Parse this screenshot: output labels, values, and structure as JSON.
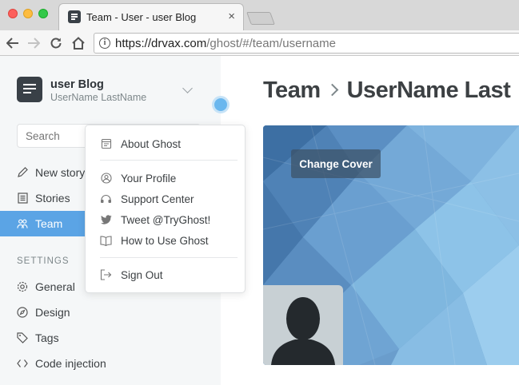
{
  "browser": {
    "tab_title": "Team - User - user Blog",
    "tab_close": "×",
    "url_host": "https://drvax.com",
    "url_rest": "/ghost/#/team/username"
  },
  "sidebar": {
    "blog_title": "user Blog",
    "user_name": "UserName LastName",
    "search_placeholder": "Search",
    "nav_items": [
      {
        "label": "New story",
        "icon": "pencil-icon"
      },
      {
        "label": "Stories",
        "icon": "stories-icon"
      },
      {
        "label": "Team",
        "icon": "team-icon",
        "active": true
      }
    ],
    "settings_heading": "SETTINGS",
    "settings_items": [
      {
        "label": "General",
        "icon": "gear-icon"
      },
      {
        "label": "Design",
        "icon": "compass-icon"
      },
      {
        "label": "Tags",
        "icon": "tag-icon"
      },
      {
        "label": "Code injection",
        "icon": "code-icon"
      }
    ]
  },
  "main": {
    "breadcrumb_parent": "Team",
    "breadcrumb_current": "UserName Last",
    "change_cover_label": "Change Cover"
  },
  "dropdown": {
    "items": [
      {
        "label": "About Ghost",
        "icon": "ghost-icon"
      },
      {
        "label": "Your Profile",
        "icon": "profile-icon"
      },
      {
        "label": "Support Center",
        "icon": "support-icon"
      },
      {
        "label": "Tweet @TryGhost!",
        "icon": "twitter-icon"
      },
      {
        "label": "How to Use Ghost",
        "icon": "book-icon"
      },
      {
        "label": "Sign Out",
        "icon": "sign-out-icon"
      }
    ]
  },
  "colors": {
    "accent": "#5ba4e5",
    "sidebar_bg": "#f5f7f8",
    "text_dark": "#3c4043"
  }
}
